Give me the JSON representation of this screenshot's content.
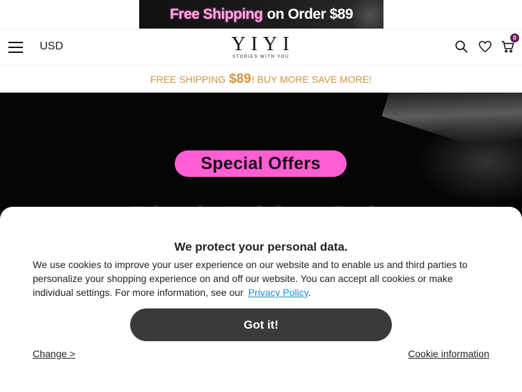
{
  "promo_banner": {
    "part1": "Free Shipping",
    "part2": "on Order $89"
  },
  "header": {
    "menu_icon": "hamburger-menu-icon",
    "currency": "USD",
    "logo": {
      "wordmark": "YIYI",
      "tagline": "STORIES WITH YOU"
    },
    "search_icon": "search-icon",
    "wishlist_icon": "heart-icon",
    "cart_icon": "cart-icon",
    "cart_count": "0"
  },
  "shipping_strip": {
    "prefix": "FREE SHIPPING ",
    "amount": "$89",
    "suffix": "! BUY MORE SAVE MORE!"
  },
  "hero": {
    "badge": "Special Offers",
    "headline": "Black Friday Sale"
  },
  "cookie_banner": {
    "title": "We protect your personal data.",
    "body": "We use cookies to improve your user experience on our website and to enable us and third parties to personalize your shopping experience on and off our website. You can accept all cookies or make individual settings. For more information, see our ",
    "privacy_link": "Privacy Policy",
    "period": ".",
    "accept_button": "Got it!",
    "change_link": "Change >",
    "cookie_info_link": "Cookie information"
  },
  "colors": {
    "accent_pink": "#ff5fd2",
    "shipping_orange": "#d6923d",
    "badge_purple": "#6b1f55",
    "button_dark": "#3a3a3a",
    "link_blue": "#1a8bd6"
  }
}
